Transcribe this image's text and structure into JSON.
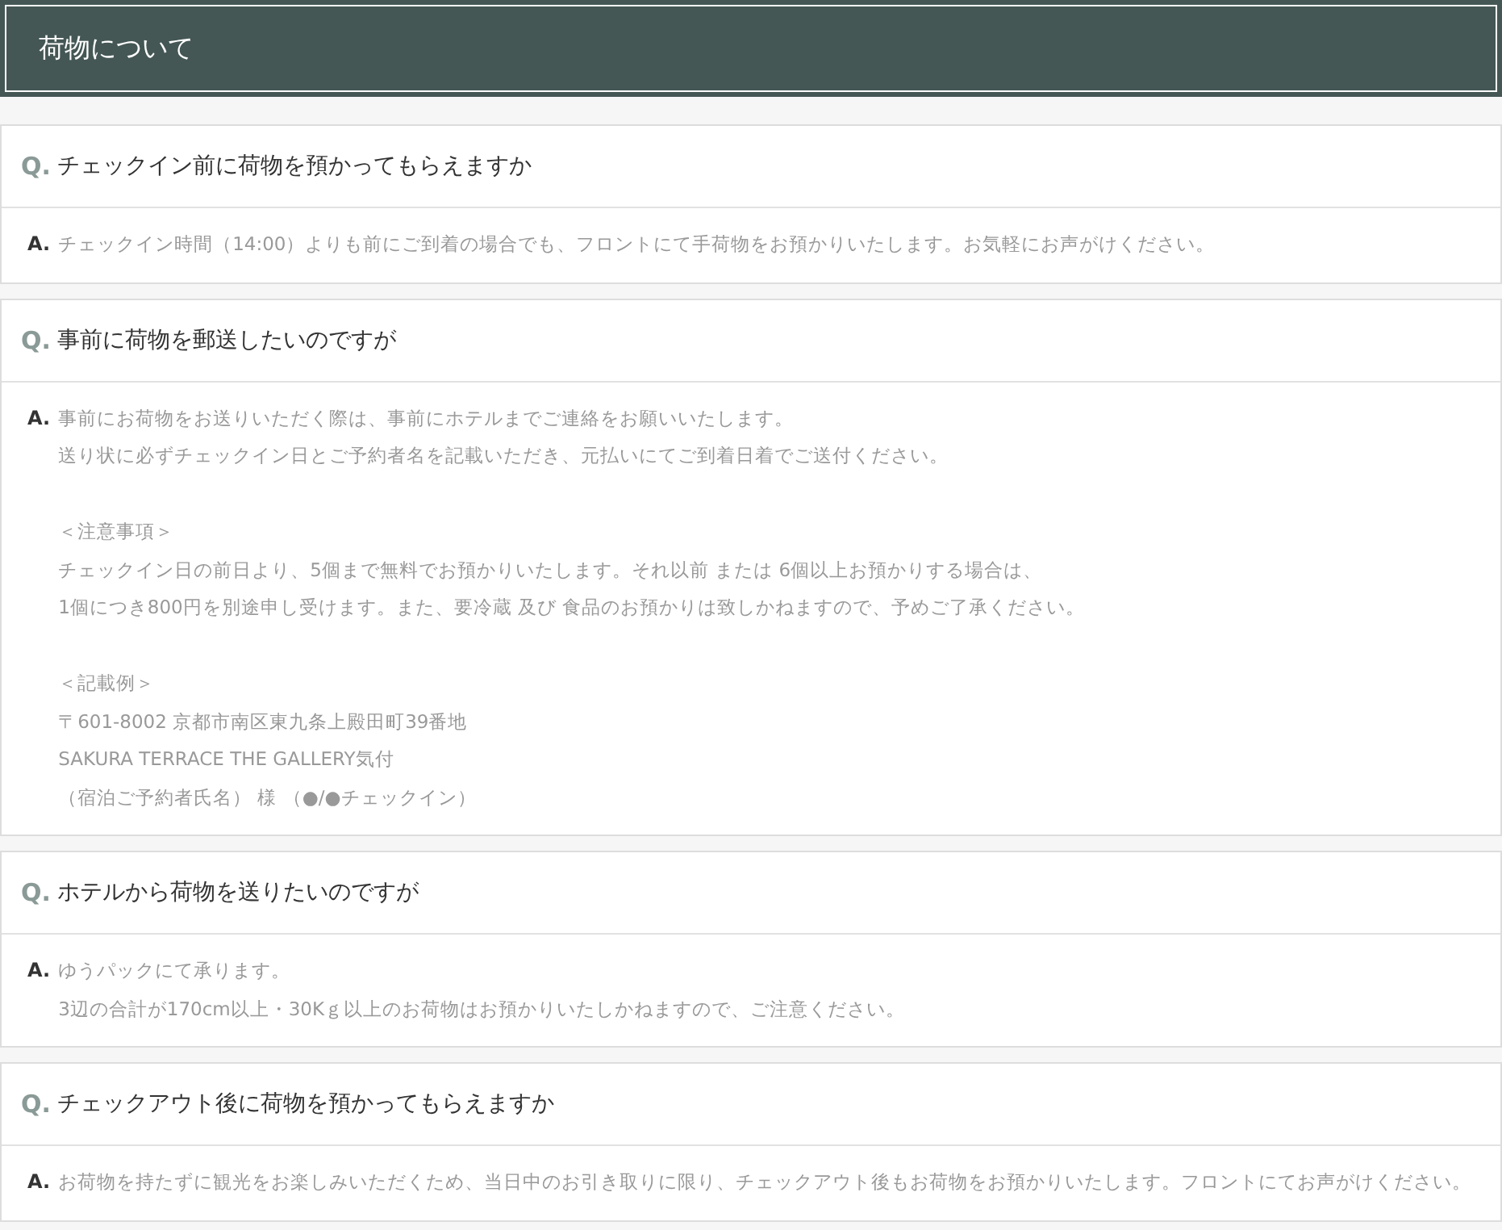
{
  "heading": "荷物について",
  "faq": [
    {
      "q_mark": "Q.",
      "question": "チェックイン前に荷物を預かってもらえますか",
      "a_mark": "A.",
      "answer": [
        [
          "チェックイン時間（14:00）よりも前にご到着の場合でも、フロントにて手荷物をお預かりいたします。お気軽にお声がけください。"
        ]
      ]
    },
    {
      "q_mark": "Q.",
      "question": "事前に荷物を郵送したいのですが",
      "a_mark": "A.",
      "answer": [
        [
          "事前にお荷物をお送りいただく際は、事前にホテルまでご連絡をお願いいたします。",
          "送り状に必ずチェックイン日とご予約者名を記載いただき、元払いにてご到着日着でご送付ください。"
        ],
        [
          "＜注意事項＞",
          "チェックイン日の前日より、5個まで無料でお預かりいたします。それ以前 または 6個以上お預かりする場合は、",
          "1個につき800円を別途申し受けます。また、要冷蔵 及び 食品のお預かりは致しかねますので、予めご了承ください。"
        ],
        [
          "＜記載例＞",
          "〒601-8002 京都市南区東九条上殿田町39番地",
          "SAKURA TERRACE THE GALLERY気付",
          "（宿泊ご予約者氏名） 様 （●/●チェックイン）"
        ]
      ]
    },
    {
      "q_mark": "Q.",
      "question": "ホテルから荷物を送りたいのですが",
      "a_mark": "A.",
      "answer": [
        [
          "ゆうパックにて承ります。",
          "3辺の合計が170cm以上・30Kｇ以上のお荷物はお預かりいたしかねますので、ご注意ください。"
        ]
      ]
    },
    {
      "q_mark": "Q.",
      "question": "チェックアウト後に荷物を預かってもらえますか",
      "a_mark": "A.",
      "answer": [
        [
          "お荷物を持たずに観光をお楽しみいただくため、当日中のお引き取りに限り、チェックアウト後もお荷物をお預かりいたします。フロントにてお声がけください。"
        ]
      ]
    }
  ]
}
